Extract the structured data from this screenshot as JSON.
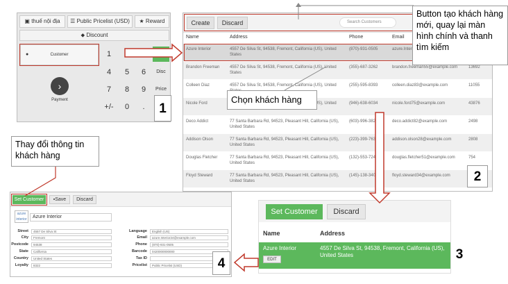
{
  "pos": {
    "top_buttons": [
      "thuế nội địa",
      "Public Pricelist (USD)",
      "Reward"
    ],
    "discount": "Discount",
    "customer": "Customer",
    "keys": [
      "1",
      "2",
      "3",
      "Qty",
      "4",
      "5",
      "6",
      "Disc",
      "7",
      "8",
      "9",
      "Price",
      "+/-",
      "0",
      ".",
      "⌫"
    ],
    "payment": "Payment",
    "panel_number": "1"
  },
  "customers": {
    "create": "Create",
    "discard": "Discard",
    "search_placeholder": "Search Customers",
    "headers": {
      "name": "Name",
      "address": "Address",
      "phone": "Phone",
      "email": "Email"
    },
    "rows": [
      {
        "name": "Azure Interior",
        "address": "4557 De Silva St, 94538, Fremont, California (US), United States",
        "phone": "(870)-931-0505",
        "email": "azure.Interior24@example.com",
        "extra": ""
      },
      {
        "name": "Brandon Freeman",
        "address": "4557 De Silva St, 94538, Fremont, California (US), United States",
        "phone": "(355)-687-3262",
        "email": "brandon.freeman55@example.com",
        "extra": "13692"
      },
      {
        "name": "Colleen Diaz",
        "address": "4557 De Silva St, 94538, Fremont, California (US), United States",
        "phone": "(255)-595-8393",
        "email": "colleen.diaz83@example.com",
        "extra": "11055"
      },
      {
        "name": "Nicole Ford",
        "address": "4557 De Silva St, 94538, Fremont, California (US), United States",
        "phone": "(946)-638-6034",
        "email": "nicole.ford75@example.com",
        "extra": "43876"
      },
      {
        "name": "Deco Addict",
        "address": "77 Santa Barbara Rd, 94523, Pleasant Hill, California (US), United States",
        "phone": "(603)-996-3829",
        "email": "deco.addict82@example.com",
        "extra": "2498"
      },
      {
        "name": "Addison Olson",
        "address": "77 Santa Barbara Rd, 94523, Pleasant Hill, California (US), United States",
        "phone": "(223)-399-7637",
        "email": "addison.olson28@example.com",
        "extra": "2808"
      },
      {
        "name": "Douglas Fletcher",
        "address": "77 Santa Barbara Rd, 94523, Pleasant Hill, California (US), United States",
        "phone": "(132)-553-7242",
        "email": "douglas.fletcher51@example.com",
        "extra": "754"
      },
      {
        "name": "Floyd Steward",
        "address": "77 Santa Barbara Rd, 94523, Pleasant Hill, California (US), United States",
        "phone": "(145)-138-3401",
        "email": "floyd.steward34@example.com",
        "extra": ""
      }
    ],
    "panel_number": "2"
  },
  "callouts": {
    "top_right": "Button tạo khách hàng mới, quay lại màn hình chính và thanh tìm kiếm",
    "select_customer": "Chọn khách hàng",
    "edit_customer": "Thay đổi thông tin khách hàng"
  },
  "selected": {
    "set_customer": "Set Customer",
    "discard": "Discard",
    "headers": {
      "name": "Name",
      "address": "Address"
    },
    "name": "Azure Interior",
    "address": "4557 De Silva St, 94538, Fremont, California (US), United States",
    "edit": "EDIT",
    "panel_number": "3"
  },
  "edit_form": {
    "set_customer": "Set Customer",
    "save": "Save",
    "discard": "Discard",
    "logo_text": "azure interior",
    "name": "Azure Interior",
    "left_fields": [
      {
        "label": "Street",
        "value": "4557 De Silva St"
      },
      {
        "label": "City",
        "value": "Fremont"
      },
      {
        "label": "Postcode",
        "value": "94538"
      },
      {
        "label": "State",
        "value": "California"
      },
      {
        "label": "Country",
        "value": "United States"
      },
      {
        "label": "Loyalty",
        "value": "8322"
      }
    ],
    "right_fields": [
      {
        "label": "Language",
        "value": "English (US)"
      },
      {
        "label": "Email",
        "value": "azure.Interior24@example.com"
      },
      {
        "label": "Phone",
        "value": "(870)-931-0505"
      },
      {
        "label": "Barcode",
        "value": "0420000000000"
      },
      {
        "label": "Tax ID",
        "value": ""
      },
      {
        "label": "Pricelist",
        "value": "Public Pricelist (USD)"
      }
    ],
    "panel_number": "4"
  },
  "colors": {
    "green": "#5cb85c",
    "red": "#c0392b",
    "dark": "#444444"
  }
}
